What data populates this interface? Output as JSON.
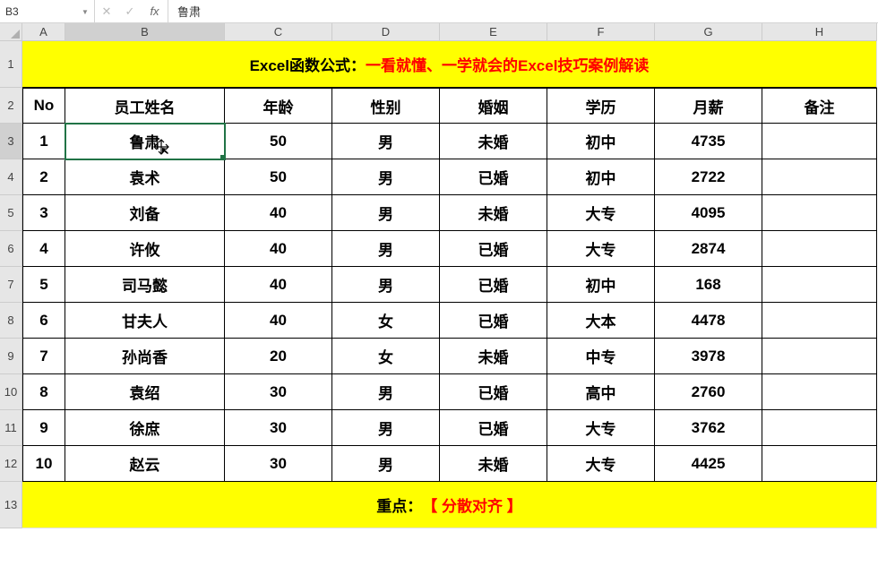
{
  "formulaBar": {
    "cellRef": "B3",
    "cellValue": "鲁肃",
    "fxLabel": "fx"
  },
  "columns": [
    "A",
    "B",
    "C",
    "D",
    "E",
    "F",
    "G",
    "H"
  ],
  "rowNumbers": [
    "1",
    "2",
    "3",
    "4",
    "5",
    "6",
    "7",
    "8",
    "9",
    "10",
    "11",
    "12",
    "13"
  ],
  "activeCell": "B3",
  "title": {
    "prefix": "Excel函数公式：",
    "main": "一看就懂、一学就会的Excel技巧案例解读"
  },
  "headers": [
    "No",
    "员工姓名",
    "年龄",
    "性别",
    "婚姻",
    "学历",
    "月薪",
    "备注"
  ],
  "rows": [
    {
      "no": "1",
      "name": "鲁肃",
      "age": "50",
      "gender": "男",
      "marriage": "未婚",
      "education": "初中",
      "salary": "4735",
      "remark": ""
    },
    {
      "no": "2",
      "name": "袁术",
      "age": "50",
      "gender": "男",
      "marriage": "已婚",
      "education": "初中",
      "salary": "2722",
      "remark": ""
    },
    {
      "no": "3",
      "name": "刘备",
      "age": "40",
      "gender": "男",
      "marriage": "未婚",
      "education": "大专",
      "salary": "4095",
      "remark": ""
    },
    {
      "no": "4",
      "name": "许攸",
      "age": "40",
      "gender": "男",
      "marriage": "已婚",
      "education": "大专",
      "salary": "2874",
      "remark": ""
    },
    {
      "no": "5",
      "name": "司马懿",
      "age": "40",
      "gender": "男",
      "marriage": "已婚",
      "education": "初中",
      "salary": "168",
      "remark": ""
    },
    {
      "no": "6",
      "name": "甘夫人",
      "age": "40",
      "gender": "女",
      "marriage": "已婚",
      "education": "大本",
      "salary": "4478",
      "remark": ""
    },
    {
      "no": "7",
      "name": "孙尚香",
      "age": "20",
      "gender": "女",
      "marriage": "未婚",
      "education": "中专",
      "salary": "3978",
      "remark": ""
    },
    {
      "no": "8",
      "name": "袁绍",
      "age": "30",
      "gender": "男",
      "marriage": "已婚",
      "education": "高中",
      "salary": "2760",
      "remark": ""
    },
    {
      "no": "9",
      "name": "徐庶",
      "age": "30",
      "gender": "男",
      "marriage": "已婚",
      "education": "大专",
      "salary": "3762",
      "remark": ""
    },
    {
      "no": "10",
      "name": "赵云",
      "age": "30",
      "gender": "男",
      "marriage": "未婚",
      "education": "大专",
      "salary": "4425",
      "remark": ""
    }
  ],
  "footer": {
    "prefix": "重点：",
    "main": "【 分散对齐 】"
  }
}
